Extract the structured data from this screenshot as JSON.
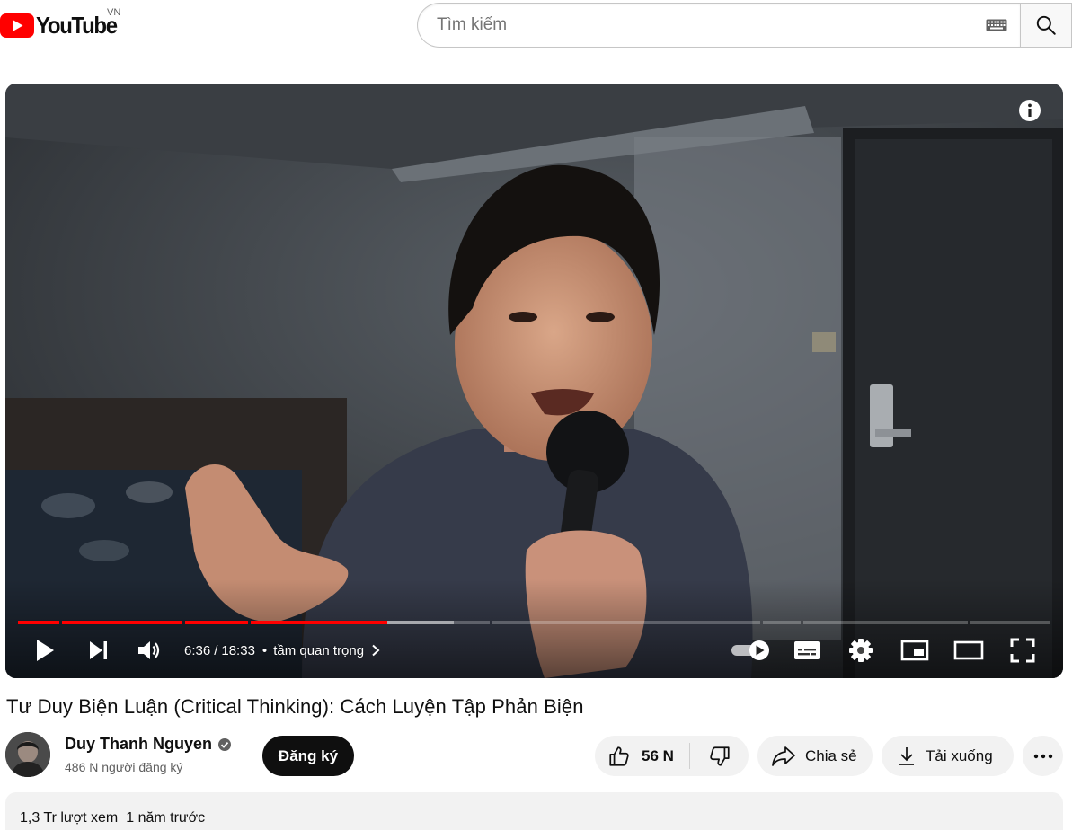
{
  "header": {
    "logo_text": "YouTube",
    "country_code": "VN",
    "search_placeholder": "Tìm kiếm"
  },
  "player": {
    "current_time": "6:36",
    "time_separator": "/",
    "duration": "18:33",
    "chapter_title": "tầm quan trọng",
    "progress_played_fraction": 0.355,
    "progress_buffered_fraction": 0.42,
    "icons": [
      "play-icon",
      "next-icon",
      "volume-icon",
      "autoplay-toggle-icon",
      "subtitles-icon",
      "settings-icon",
      "miniplayer-icon",
      "theater-mode-icon",
      "fullscreen-icon",
      "info-icon"
    ]
  },
  "video": {
    "title": "Tư Duy Biện Luận (Critical Thinking): Cách Luyện Tập Phản Biện",
    "channel_name": "Duy Thanh Nguyen",
    "subscriber_count": "486 N người đăng ký",
    "subscribe_label": "Đăng ký",
    "like_count": "56 N",
    "share_label": "Chia sẻ",
    "download_label": "Tải xuống"
  },
  "description": {
    "views": "1,3 Tr lượt xem",
    "published": "1 năm trước"
  },
  "colors": {
    "brand_red": "#ff0000",
    "subscribe_bg": "#0f0f0f",
    "pill_bg": "#f2f2f2"
  }
}
